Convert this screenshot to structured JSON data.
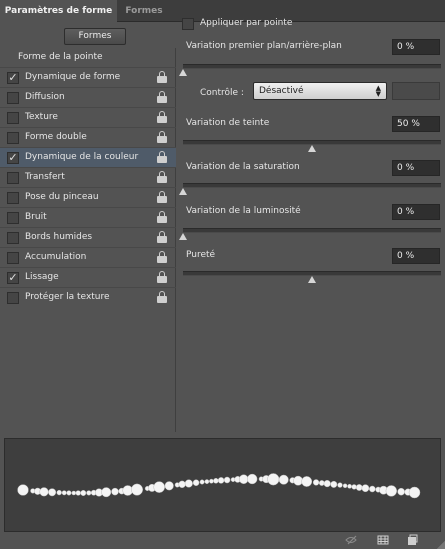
{
  "tabs": {
    "active": "Paramètres de forme",
    "inactive": "Formes"
  },
  "formes_button": "Formes",
  "section_title": "Forme de la pointe",
  "options": [
    {
      "label": "Dynamique de forme",
      "checked": true
    },
    {
      "label": "Diffusion",
      "checked": false
    },
    {
      "label": "Texture",
      "checked": false
    },
    {
      "label": "Forme double",
      "checked": false
    },
    {
      "label": "Dynamique de la couleur",
      "checked": true,
      "selected": true
    },
    {
      "label": "Transfert",
      "checked": false
    },
    {
      "label": "Pose du pinceau",
      "checked": false
    },
    {
      "label": "Bruit",
      "checked": false
    },
    {
      "label": "Bords humides",
      "checked": false
    },
    {
      "label": "Accumulation",
      "checked": false
    },
    {
      "label": "Lissage",
      "checked": true
    },
    {
      "label": "Protéger la texture",
      "checked": false
    }
  ],
  "check_glyph": "✓",
  "apply_per_tip": {
    "label": "Appliquer par pointe",
    "checked": false
  },
  "settings": {
    "fg_bg": {
      "label": "Variation premier plan/arrière-plan",
      "value": "0 %",
      "slider": 0.0
    },
    "control": {
      "label": "Contrôle :",
      "value": "Désactivé",
      "arrows": "▲\n▼"
    },
    "hue": {
      "label": "Variation de teinte",
      "value": "50 %",
      "slider": 0.5
    },
    "saturation": {
      "label": "Variation de la saturation",
      "value": "0 %",
      "slider": 0.0
    },
    "brightness": {
      "label": "Variation de la luminosité",
      "value": "0 %",
      "slider": 0.0
    },
    "purity": {
      "label": "Pureté",
      "value": "0 %",
      "slider": 0.5
    }
  },
  "icons": {
    "lock": "lock-icon",
    "preview_toggle": "eye-brush-icon",
    "grid": "grid-icon",
    "new_preset": "new-preset-icon"
  },
  "colors": {
    "panel_bg": "#535353",
    "selected_row": "#4f5b69",
    "preview_bg": "#3e3e3e",
    "field_bg": "#2f2f2f"
  }
}
